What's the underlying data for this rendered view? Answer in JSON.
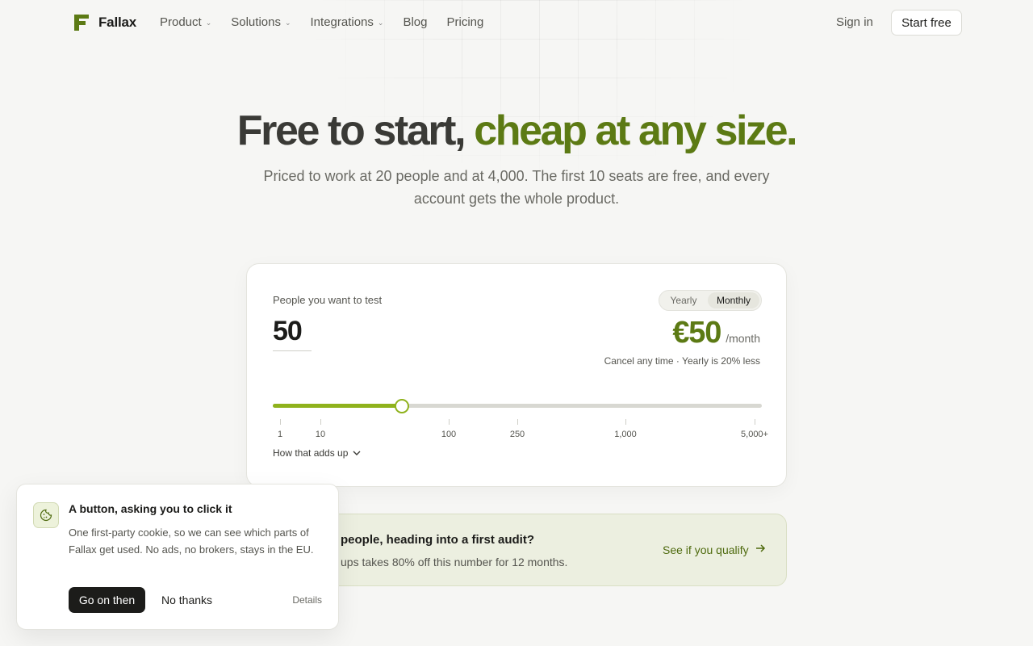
{
  "nav": {
    "brand": "Fallax",
    "links": [
      {
        "label": "Product",
        "dropdown": true
      },
      {
        "label": "Solutions",
        "dropdown": true
      },
      {
        "label": "Integrations",
        "dropdown": true
      },
      {
        "label": "Blog",
        "dropdown": false
      },
      {
        "label": "Pricing",
        "dropdown": false
      }
    ],
    "sign_in": "Sign in",
    "start_free": "Start free"
  },
  "hero": {
    "title_main": "Free to start,",
    "title_accent": "cheap at any size.",
    "subtitle": "Priced to work at 20 people and at 4,000. The first 10 seats are free, and every account gets the whole product."
  },
  "pricing": {
    "people_label": "People you want to test",
    "people_value": "50",
    "billing_options": [
      "Yearly",
      "Monthly"
    ],
    "billing_selected": "Monthly",
    "price": "€50",
    "price_unit": "/month",
    "price_note": "Cancel any time · Yearly is 20% less",
    "slider_level": 0.264,
    "slider_ticks": [
      "1",
      "10",
      "100",
      "250",
      "1,000",
      "5,000+"
    ],
    "adds_up": "How that adds up"
  },
  "promo": {
    "title": "people, heading into a first audit?",
    "text": "ups takes 80% off this number for 12 months.",
    "link": "See if you qualify"
  },
  "cookie": {
    "title": "A button, asking you to click it",
    "text": "One first-party cookie, so we can see which parts of Fallax get used. No ads, no brokers, stays in the EU.",
    "accept": "Go on then",
    "decline": "No thanks",
    "details": "Details"
  },
  "colors": {
    "accent": "#5c7a14",
    "slider": "#8fb21c",
    "promo_bg": "#ecefe0"
  }
}
